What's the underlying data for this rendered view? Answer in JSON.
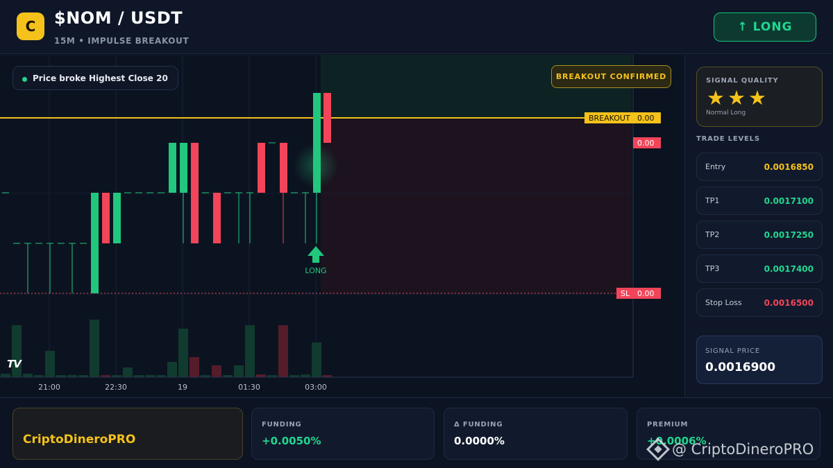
{
  "header": {
    "logo_letter": "C",
    "pair": "$NOM / USDT",
    "subtitle": "15M • IMPULSE BREAKOUT",
    "action_button": "↑ LONG"
  },
  "chart": {
    "indicator_text": "Price broke Highest Close 20",
    "status_badge": "BREAKOUT CONFIRMED",
    "breakout_tag": "BREAKOUT",
    "breakout_value": "0.00",
    "tp_value": "0.00",
    "sl_tag": "SL",
    "sl_value": "0.00",
    "signal_label": "LONG",
    "tv_logo": "TV",
    "time_labels": [
      "21:00",
      "22:30",
      "19",
      "01:30",
      "03:00"
    ],
    "colors": {
      "up": "#22c77e",
      "down": "#f2455a",
      "breakout": "#f4c21b",
      "grid": "#182238"
    }
  },
  "chart_data": {
    "type": "candlestick",
    "title": "",
    "y_levels": {
      "breakout": 0.00169,
      "entry": 0.001685,
      "stop_loss": 0.00165
    },
    "time_ticks": [
      "21:00",
      "22:30",
      "19",
      "01:30",
      "03:00"
    ]
  },
  "sidebar": {
    "quality_title": "SIGNAL QUALITY",
    "quality_stars": "★★★",
    "quality_rating": 3,
    "quality_sub": "Normal Long",
    "levels_title": "TRADE LEVELS",
    "levels": [
      {
        "name": "Entry",
        "value": "0.0016850",
        "color": "#f4c21b"
      },
      {
        "name": "TP1",
        "value": "0.0017100",
        "color": "#22d68f"
      },
      {
        "name": "TP2",
        "value": "0.0017250",
        "color": "#22d68f"
      },
      {
        "name": "TP3",
        "value": "0.0017400",
        "color": "#22d68f"
      },
      {
        "name": "Stop Loss",
        "value": "0.0016500",
        "color": "#f2455a"
      }
    ],
    "signal_price_label": "SIGNAL PRICE",
    "signal_price_value": "0.0016900"
  },
  "footer": {
    "brand": "CriptoDineroPRO",
    "metrics": [
      {
        "label": "FUNDING",
        "value": "+0.0050%",
        "color": "#22d68f"
      },
      {
        "label": "Δ FUNDING",
        "value": "0.0000%",
        "color": "#ffffff"
      },
      {
        "label": "PREMIUM",
        "value": "+0.0006%",
        "color": "#22d68f"
      }
    ],
    "watermark": "@ CriptoDineroPRO"
  }
}
